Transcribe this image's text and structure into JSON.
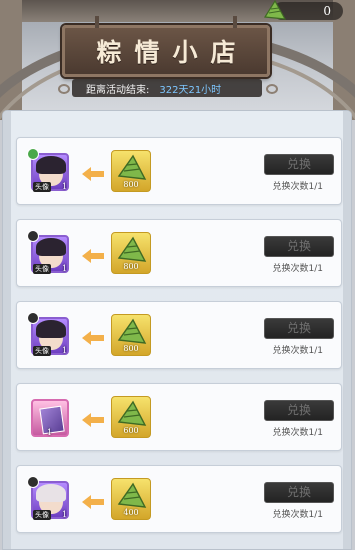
{
  "header": {
    "currency_value": "0",
    "currency_icon": "zongzi-icon",
    "title": "粽情小店",
    "timer_label": "距离活动结束:",
    "timer_value": "322天21小时"
  },
  "rows": [
    {
      "reward": "portrait-avatar",
      "reward_qty": "1",
      "reward_tag": "头像",
      "cost": "800",
      "button": "兑换",
      "limit": "兑换次数1/1"
    },
    {
      "reward": "portrait-avatar",
      "reward_qty": "1",
      "reward_tag": "头像",
      "cost": "800",
      "button": "兑换",
      "limit": "兑换次数1/1"
    },
    {
      "reward": "portrait-avatar",
      "reward_qty": "1",
      "reward_tag": "头像",
      "cost": "800",
      "button": "兑换",
      "limit": "兑换次数1/1"
    },
    {
      "reward": "book-item",
      "reward_qty": "1",
      "reward_tag": "",
      "cost": "600",
      "button": "兑换",
      "limit": "兑换次数1/1"
    },
    {
      "reward": "portrait-avatar",
      "reward_qty": "1",
      "reward_tag": "头像",
      "cost": "400",
      "button": "兑换",
      "limit": "兑换次数1/1"
    }
  ],
  "colors": {
    "timer_value": "#7ec7ff",
    "sign": "#5b473a",
    "panel": "#e3e9ef"
  }
}
